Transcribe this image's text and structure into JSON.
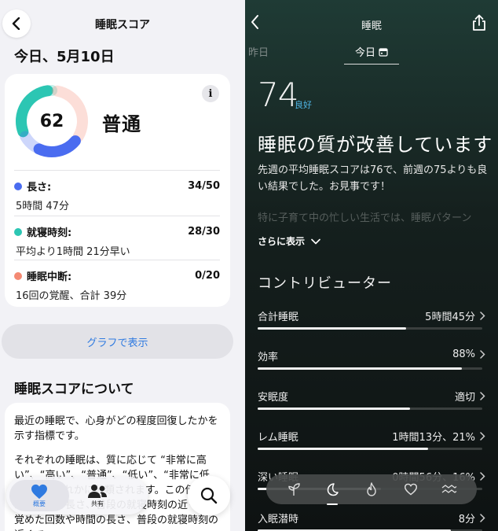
{
  "left": {
    "title": "睡眠スコア",
    "date": "今日、5月10日",
    "score": "62",
    "level": "普通",
    "ring_parts": [
      {
        "name": "長さ",
        "fraction": 0.68,
        "color": "#4a6cf0"
      },
      {
        "name": "就寝時刻",
        "fraction": 0.93,
        "color": "#2cc6b3"
      },
      {
        "name": "睡眠中断",
        "fraction": 0.0,
        "color": "#f48a73"
      }
    ],
    "info": "i",
    "metrics": [
      {
        "name": "長さ:",
        "value": "34/50",
        "detail": "5時間 47分",
        "color": "#4a6cf0"
      },
      {
        "name": "就寝時刻:",
        "value": "28/30",
        "detail": "平均より1時間 21分早い",
        "color": "#2cc6b3"
      },
      {
        "name": "睡眠中断:",
        "value": "0/20",
        "detail": "16回の覚醒、合計 39分",
        "color": "#f48a73"
      }
    ],
    "graph_button": "グラフで表示",
    "about_title": "睡眠スコアについて",
    "about_p1": "最近の睡眠で、心身がどの程度回復したかを示す指標です。",
    "about_p2": "それぞれの睡眠は、質に応じて “非常に高い”、“高い”、“普通”、“低い”、“非常に低い” のいずれかに分類されます。この値は、睡眠時間の長さ、普段の就寝時刻の近くで目覚めた回数や時間の長さ、普段の就寝時刻の近くで",
    "tabs": {
      "summary": "概要",
      "share": "共有"
    }
  },
  "right": {
    "title": "睡眠",
    "tab_prev": "昨日",
    "tab_today": "今日",
    "score": "74",
    "score_label": "良好",
    "headline": "睡眠の質が改善しています",
    "description": "先週の平均睡眠スコアは76で、前週の75よりも良い結果でした。お見事です！",
    "description_more": "特に子育て中の忙しい生活では、睡眠パターン",
    "show_more": "さらに表示",
    "contributors_title": "コントリビューター",
    "contributors": [
      {
        "label": "合計睡眠",
        "value": "5時間45分",
        "level": 0.66
      },
      {
        "label": "効率",
        "value": "88%",
        "level": 0.91
      },
      {
        "label": "安眠度",
        "value": "適切",
        "level": 0.68
      },
      {
        "label": "レム睡眠",
        "value": "1時間13分、21%",
        "level": 0.76
      },
      {
        "label": "深い睡眠",
        "value": "0時間56分、16%",
        "level": 0.55
      },
      {
        "label": "入眠潜時",
        "value": "8分",
        "level": 0.86
      }
    ],
    "nav_icons": [
      "sprout-icon",
      "moon-icon",
      "flame-icon",
      "heart-icon",
      "waves-icon"
    ]
  }
}
